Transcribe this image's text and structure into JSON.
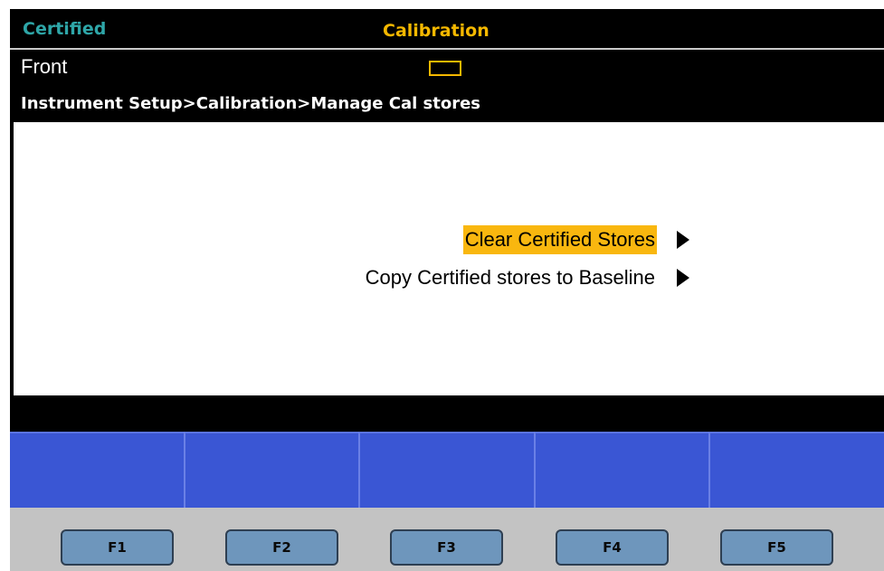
{
  "header": {
    "mode": "Certified",
    "title": "Calibration"
  },
  "info": {
    "terminals": "Front",
    "breadcrumb": "Instrument Setup>Calibration>Manage Cal stores"
  },
  "menu": {
    "items": [
      {
        "label": "Clear Certified Stores",
        "selected": true
      },
      {
        "label": "Copy Certified stores to Baseline",
        "selected": false
      }
    ]
  },
  "softkeys": [
    "",
    "",
    "",
    "",
    ""
  ],
  "function_keys": [
    "F1",
    "F2",
    "F3",
    "F4",
    "F5"
  ],
  "colors": {
    "mode_text": "#2ea6a8",
    "title_text": "#f5b800",
    "selection_highlight": "#f9b70f",
    "softkey_blue": "#3a56d4",
    "fkey_blue": "#6e96bc",
    "bezel_gray": "#c3c3c3"
  }
}
